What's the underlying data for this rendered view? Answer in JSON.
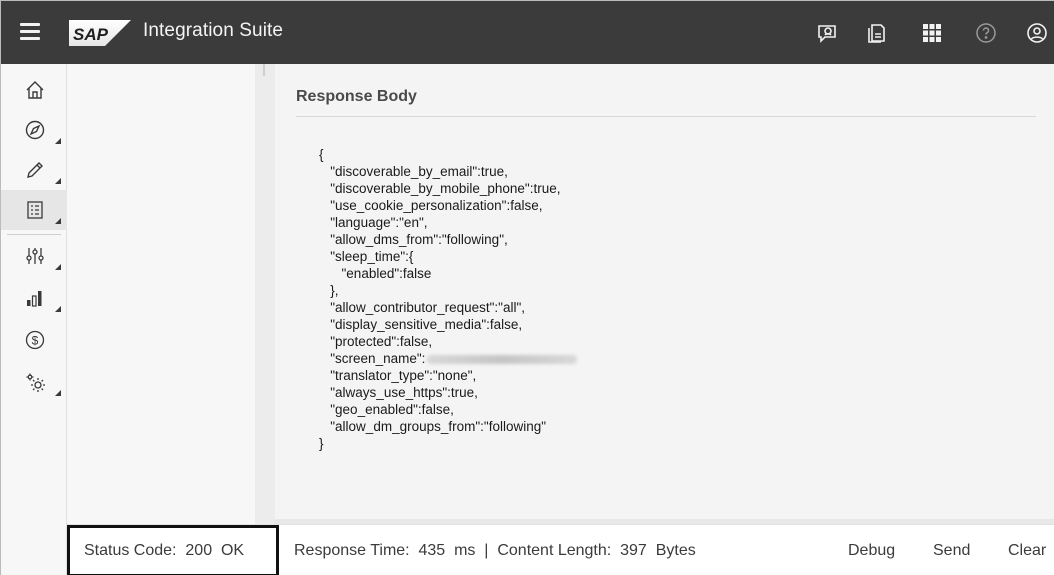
{
  "app": {
    "brand_name": "Integration Suite",
    "logo_text": "SAP"
  },
  "shell_icons": [
    "feedback-icon",
    "notes-icon",
    "app-grid-icon",
    "help-icon",
    "user-icon"
  ],
  "sidenav": {
    "items": [
      {
        "name": "home-icon",
        "has_expander": false
      },
      {
        "name": "discover-icon",
        "has_expander": true
      },
      {
        "name": "design-icon",
        "has_expander": true
      },
      {
        "name": "test-icon",
        "has_expander": true,
        "selected": true
      },
      {
        "name": "configure-icon",
        "has_expander": true
      },
      {
        "name": "monitor-icon",
        "has_expander": true
      },
      {
        "name": "billing-icon",
        "has_expander": false
      },
      {
        "name": "settings-icon",
        "has_expander": true
      }
    ]
  },
  "response": {
    "title": "Response Body",
    "lines": [
      "{",
      "   \"discoverable_by_email\":true,",
      "   \"discoverable_by_mobile_phone\":true,",
      "   \"use_cookie_personalization\":false,",
      "   \"language\":\"en\",",
      "   \"allow_dms_from\":\"following\",",
      "   \"sleep_time\":{",
      "      \"enabled\":false",
      "   },",
      "   \"allow_contributor_request\":\"all\",",
      "   \"display_sensitive_media\":false,",
      "   \"protected\":false,",
      "   \"screen_name\":",
      "   \"translator_type\":\"none\",",
      "   \"always_use_https\":true,",
      "   \"geo_enabled\":false,",
      "   \"allow_dm_groups_from\":\"following\"",
      "}"
    ],
    "redacted_line_index": 12
  },
  "footer": {
    "status_code_label": "Status Code:  200  OK",
    "response_info": "Response Time:  435  ms  |  Content Length:  397  Bytes",
    "debug_label": "Debug",
    "send_label": "Send",
    "clear_label": "Clear"
  },
  "colors": {
    "shell_bg": "#3b3b3b",
    "panel_bg": "#f4f4f4",
    "sidenav_bg": "#f7f7f7",
    "highlight_border": "#111111"
  }
}
